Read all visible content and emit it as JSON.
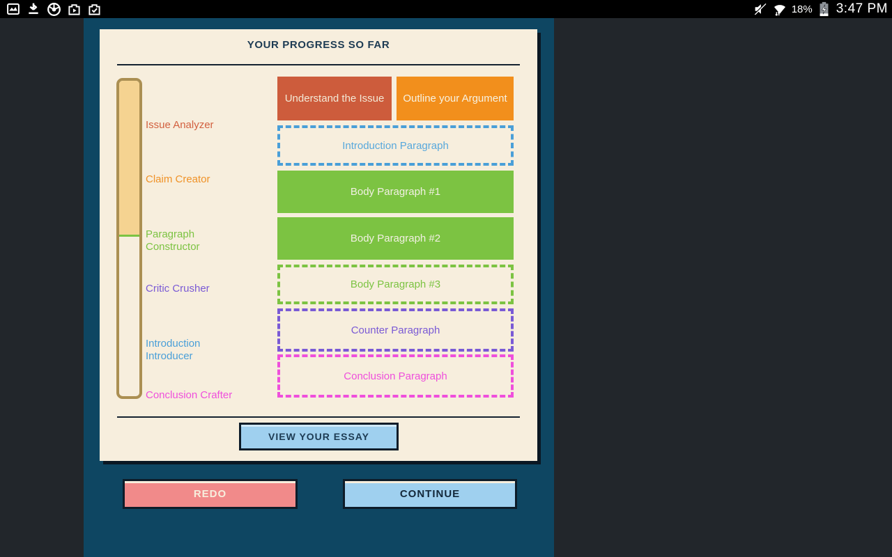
{
  "status_bar": {
    "time": "3:47 PM",
    "battery_percent": "18%",
    "battery_charging": true,
    "left_icons": [
      "gallery-icon",
      "download-icon",
      "chrome-icon",
      "play-store-icon",
      "checkmark-app-icon"
    ],
    "right_icons": [
      "mute-icon",
      "wifi-icon",
      "battery-icon"
    ]
  },
  "panel": {
    "background_color": "#0e4662",
    "card": {
      "title": "YOUR PROGRESS SO FAR",
      "progress_fill_percent": 49,
      "milestones": [
        {
          "label": "Issue Analyzer",
          "color": "#d2603f"
        },
        {
          "label": "Claim Creator",
          "color": "#f09227"
        },
        {
          "label": "Paragraph Constructor",
          "color": "#7cc342"
        },
        {
          "label": "Critic Crusher",
          "color": "#7a5ad5"
        },
        {
          "label": "Introduction Introducer",
          "color": "#4a9fd8"
        },
        {
          "label": "Conclusion Crafter",
          "color": "#ef4fdc"
        }
      ],
      "stages": [
        {
          "label": "Understand the Issue",
          "state": "complete",
          "style": "solid",
          "color": "#cd5c3c"
        },
        {
          "label": "Outline your Argument",
          "state": "complete",
          "style": "solid",
          "color": "#f28f1c"
        },
        {
          "label": "Introduction Paragraph",
          "state": "incomplete",
          "style": "dashed",
          "color": "#4a9fd8"
        },
        {
          "label": "Body Paragraph #1",
          "state": "complete",
          "style": "solid",
          "color": "#7cc342"
        },
        {
          "label": "Body Paragraph #2",
          "state": "complete",
          "style": "solid",
          "color": "#7cc342"
        },
        {
          "label": "Body Paragraph #3",
          "state": "incomplete",
          "style": "dashed",
          "color": "#7cc342"
        },
        {
          "label": "Counter Paragraph",
          "state": "incomplete",
          "style": "dashed",
          "color": "#7a5ad5"
        },
        {
          "label": "Conclusion Paragraph",
          "state": "incomplete",
          "style": "dashed",
          "color": "#ef4fdc"
        }
      ],
      "view_essay_label": "VIEW YOUR ESSAY"
    },
    "redo_label": "REDO",
    "continue_label": "CONTINUE"
  }
}
